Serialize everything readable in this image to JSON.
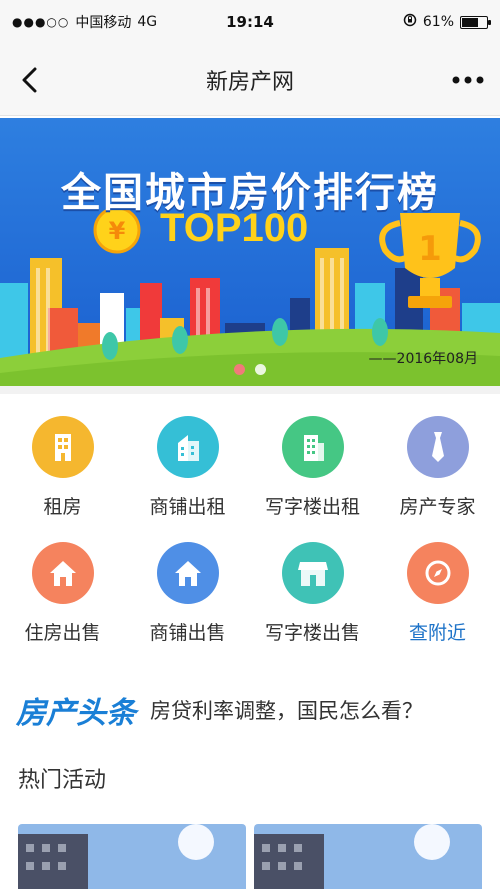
{
  "status_bar": {
    "signal": "●●●○○",
    "carrier": "中国移动",
    "network": "4G",
    "time": "19:14",
    "battery_percent": "61%",
    "battery_level": 0.61
  },
  "navbar": {
    "title": "新房产网",
    "back_icon": "chevron-left-icon",
    "more_icon": "more-icon"
  },
  "banner": {
    "title": "全国城市房价排行榜",
    "subtitle": "TOP100",
    "date": "——2016年08月",
    "coin_symbol": "¥",
    "trophy_digit": "1",
    "active_slide": 1,
    "slide_count": 2
  },
  "grid": {
    "items": [
      {
        "label": "租房",
        "icon": "building-icon",
        "color": "#f5b72f"
      },
      {
        "label": "商铺出租",
        "icon": "shop-building-icon",
        "color": "#35bfd6"
      },
      {
        "label": "写字楼出租",
        "icon": "office-building-icon",
        "color": "#45c784"
      },
      {
        "label": "房产专家",
        "icon": "tie-icon",
        "color": "#8e9fdc"
      },
      {
        "label": "住房出售",
        "icon": "house-icon",
        "color": "#f5835e"
      },
      {
        "label": "商铺出售",
        "icon": "house-icon",
        "color": "#4f8fe6"
      },
      {
        "label": "写字楼出售",
        "icon": "store-icon",
        "color": "#3fc2b6"
      },
      {
        "label": "查附近",
        "icon": "compass-icon",
        "color": "#f5835e"
      }
    ]
  },
  "headline": {
    "brand": "房产头条",
    "text": "房贷利率调整，国民怎么看？"
  },
  "hot": {
    "title": "热门活动"
  }
}
